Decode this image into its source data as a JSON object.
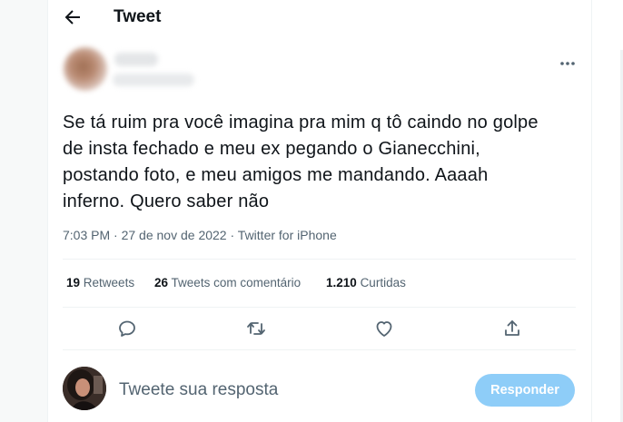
{
  "header": {
    "title": "Tweet",
    "back_icon": "arrow-left-icon"
  },
  "tweet": {
    "text": "Se tá ruim pra você imagina pra mim q tô caindo no golpe de insta fechado e meu ex pegando o Gianecchini, postando foto, e meu amigos me mandando. Aaaah inferno. Quero saber não",
    "time": "7:03 PM",
    "date": "27 de nov de 2022",
    "source": "Twitter for iPhone",
    "more_icon": "more-horizontal-icon"
  },
  "stats": {
    "retweets": {
      "count": "19",
      "label": "Retweets"
    },
    "quotes": {
      "count": "26",
      "label": "Tweets com comentário"
    },
    "likes": {
      "count": "1.210",
      "label": "Curtidas"
    }
  },
  "actions": [
    "reply-icon",
    "retweet-icon",
    "like-icon",
    "share-icon"
  ],
  "reply": {
    "placeholder": "Tweete sua resposta",
    "button_label": "Responder"
  },
  "colors": {
    "text": "#0f1419",
    "secondary": "#536471",
    "border": "#eff3f4",
    "reply_button_disabled": "#8ecdf8"
  }
}
